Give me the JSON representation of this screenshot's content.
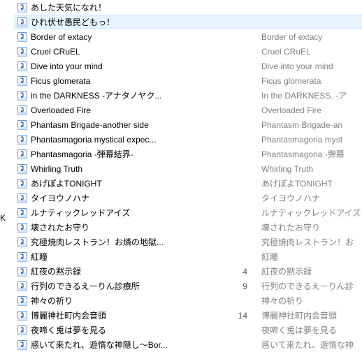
{
  "edge_label": "K",
  "rows": [
    {
      "title": "あした天気になれ！",
      "count": "",
      "album": "",
      "selected": false
    },
    {
      "title": "ひれ伏せ愚民どもっ！",
      "count": "",
      "album": "",
      "selected": true
    },
    {
      "title": "Border of extacy",
      "count": "",
      "album": "Border of extacy",
      "selected": false
    },
    {
      "title": "Cruel CRuEL",
      "count": "",
      "album": "Cruel CRuEL",
      "selected": false
    },
    {
      "title": "Dive into your mind",
      "count": "",
      "album": "Dive into your mind",
      "selected": false
    },
    {
      "title": "Ficus glomerata",
      "count": "",
      "album": "Ficus glomerata",
      "selected": false
    },
    {
      "title": "in the DARKNESS -アナタノヤク...",
      "count": "",
      "album": "In the DARKNESS. -ア",
      "selected": false
    },
    {
      "title": "Overloaded Fire",
      "count": "",
      "album": "Overloaded Fire",
      "selected": false
    },
    {
      "title": "Phantasm Brigade-another side",
      "count": "",
      "album": "Phantasm Brigade-an",
      "selected": false
    },
    {
      "title": "Phantasmagoria mystical expec...",
      "count": "",
      "album": "Phantasmagoria myst",
      "selected": false
    },
    {
      "title": "Phantasmagoria -弾幕結界-",
      "count": "",
      "album": "Phantasmagoria -弾幕",
      "selected": false
    },
    {
      "title": "Whirling Truth",
      "count": "",
      "album": "Whirling Truth",
      "selected": false
    },
    {
      "title": "あげぽよTONIGHT",
      "count": "",
      "album": "あげぽよTONIGHT",
      "selected": false
    },
    {
      "title": "タイヨウノハナ",
      "count": "",
      "album": "タイヨウノハナ",
      "selected": false
    },
    {
      "title": "ルナティックレッドアイズ",
      "count": "",
      "album": "ルナティックレッドアイズ",
      "selected": false
    },
    {
      "title": "壊されたお守り",
      "count": "",
      "album": "壊されたお守り",
      "selected": false
    },
    {
      "title": "究極焼肉レストラン！お燐の地獄...",
      "count": "",
      "album": "究極焼肉レストラン！お",
      "selected": false
    },
    {
      "title": "紅瞳",
      "count": "",
      "album": "紅瞳",
      "selected": false
    },
    {
      "title": "紅夜の黙示録",
      "count": "4",
      "album": "紅夜の黙示録",
      "selected": false
    },
    {
      "title": "行列のできるえーりん診療所",
      "count": "9",
      "album": "行列のできるえーりん診",
      "selected": false
    },
    {
      "title": "神々の祈り",
      "count": "",
      "album": "神々の祈り",
      "selected": false
    },
    {
      "title": "博麗神社町内会音頭",
      "count": "14",
      "album": "博麗神社町内会音頭",
      "selected": false
    },
    {
      "title": "夜啼く兎は夢を見る",
      "count": "",
      "album": "夜啼く兎は夢を見る",
      "selected": false
    },
    {
      "title": "惑いて来たれ、遊惰な神隠し～Bor...",
      "count": "",
      "album": "惑いて来たれ、遊惰な神",
      "selected": false
    }
  ]
}
